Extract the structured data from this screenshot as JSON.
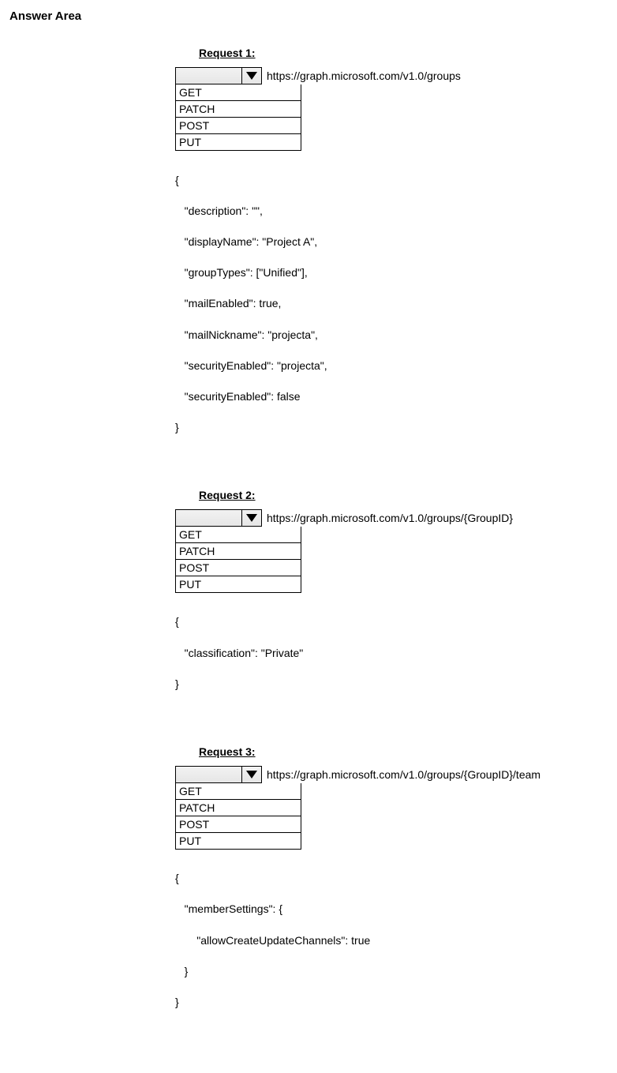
{
  "pageTitle": "Answer Area",
  "requests": [
    {
      "title": "Request 1:",
      "options": [
        "GET",
        "PATCH",
        "POST",
        "PUT"
      ],
      "url": "https://graph.microsoft.com/v1.0/groups",
      "bodyLines": [
        "{",
        "   \"description\": \"\",",
        "   \"displayName\": \"Project A\",",
        "   \"groupTypes\": [\"Unified\"],",
        "   \"mailEnabled\": true,",
        "   \"mailNickname\": \"projecta\",",
        "   \"securityEnabled\": \"projecta\",",
        "   \"securityEnabled\": false",
        "}"
      ]
    },
    {
      "title": "Request 2:",
      "options": [
        "GET",
        "PATCH",
        "POST",
        "PUT"
      ],
      "url": "https://graph.microsoft.com/v1.0/groups/{GroupID}",
      "bodyLines": [
        "{",
        "   \"classification\": \"Private\"",
        "}"
      ]
    },
    {
      "title": "Request 3:",
      "options": [
        "GET",
        "PATCH",
        "POST",
        "PUT"
      ],
      "url": "https://graph.microsoft.com/v1.0/groups/{GroupID}/team",
      "bodyLines": [
        "{",
        "   \"memberSettings\": {",
        "       \"allowCreateUpdateChannels\": true",
        "   }",
        "}"
      ]
    }
  ]
}
